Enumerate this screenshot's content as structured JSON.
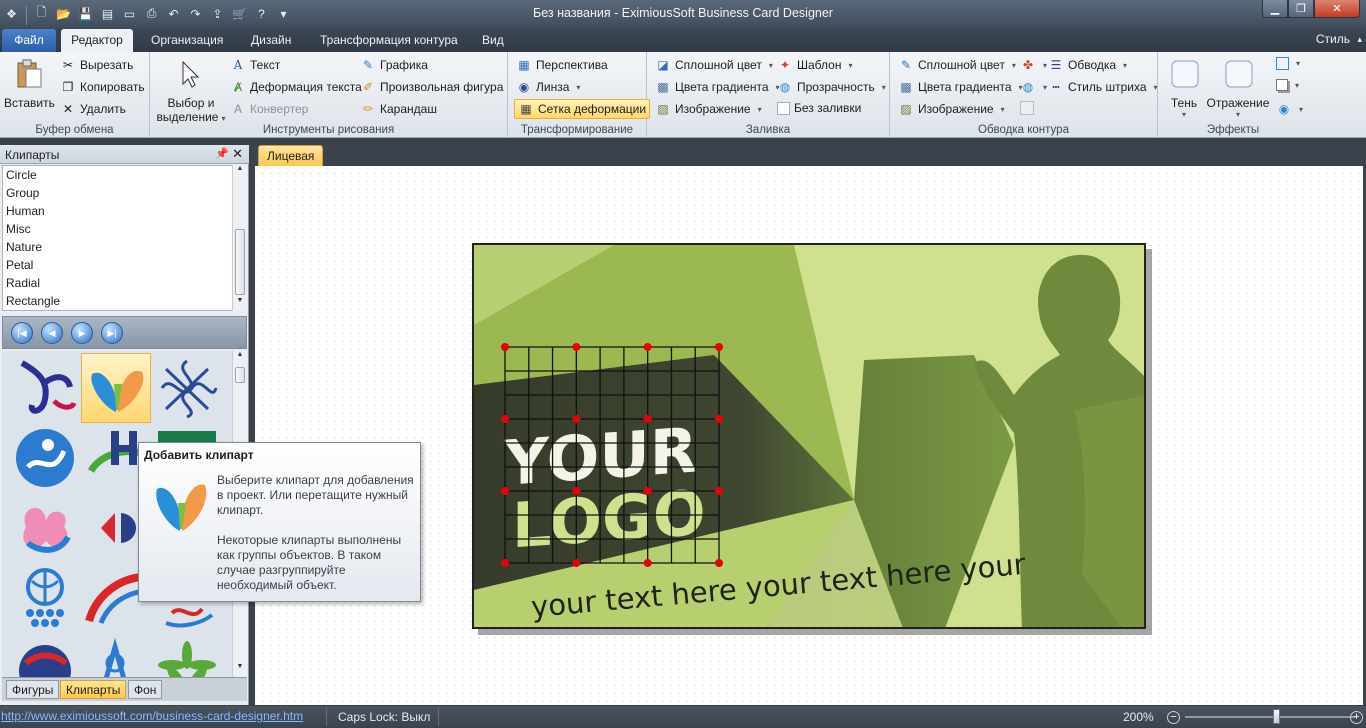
{
  "window": {
    "title": "Без названия - EximiousSoft Business Card Designer"
  },
  "tabs": {
    "file": "Файл",
    "editor": "Редактор",
    "organization": "Организация",
    "design": "Дизайн",
    "path": "Трансформация контура",
    "view": "Вид",
    "style": "Стиль"
  },
  "ribbon": {
    "clipboard": {
      "title": "Буфер обмена",
      "paste": "Вставить",
      "cut": "Вырезать",
      "copy": "Копировать",
      "delete": "Удалить"
    },
    "draw": {
      "title": "Инструменты рисования",
      "select": "Выбор и",
      "select2": "выделение",
      "text": "Текст",
      "warp_text": "Деформация текста",
      "converter": "Конвертер",
      "graphics": "Графика",
      "freeform": "Произвольная фигура",
      "pencil": "Карандаш"
    },
    "transform": {
      "title": "Трансформирование",
      "perspective": "Перспектива",
      "lens": "Линза",
      "mesh": "Сетка деформации"
    },
    "fill": {
      "title": "Заливка",
      "solid": "Сплошной цвет",
      "gradient": "Цвета градиента",
      "image": "Изображение",
      "pattern": "Шаблон",
      "transparency": "Прозрачность",
      "no_fill": "Без заливки"
    },
    "outline": {
      "title": "Обводка контура",
      "solid": "Сплошной цвет",
      "gradient": "Цвета градиента",
      "image": "Изображение",
      "stroke": "Обводка",
      "dash": "Стиль штриха"
    },
    "effects": {
      "title": "Эффекты",
      "shadow": "Тень",
      "reflection": "Отражение"
    }
  },
  "panel": {
    "title": "Клипарты",
    "categories": [
      "Circle",
      "Group",
      "Human",
      "Misc",
      "Nature",
      "Petal",
      "Radial",
      "Rectangle"
    ],
    "bottom_tabs": {
      "shapes": "Фигуры",
      "cliparts": "Клипарты",
      "background": "Фон"
    }
  },
  "document": {
    "tab": "Лицевая"
  },
  "card": {
    "logo_line1": "YOUR",
    "logo_line2": "LOGO",
    "tagline": "your text here your text here your"
  },
  "tooltip": {
    "title": "Добавить клипарт",
    "line1": "Выберите клипарт для добавления в проект. Или перетащите нужный клипарт.",
    "line2": "Некоторые клипарты выполнены как группы объектов. В таком случае разгруппируйте необходимый объект."
  },
  "status": {
    "url": "http://www.eximioussoft.com/business-card-designer.htm",
    "caps": "Caps Lock: Выкл",
    "zoom": "200%"
  },
  "colors": {
    "card_light": "#cfe08e",
    "card_mid": "#9bb851",
    "card_dark": "#363c2a",
    "silhouette": "#6f8a3d",
    "accent_red": "#e8000b"
  }
}
